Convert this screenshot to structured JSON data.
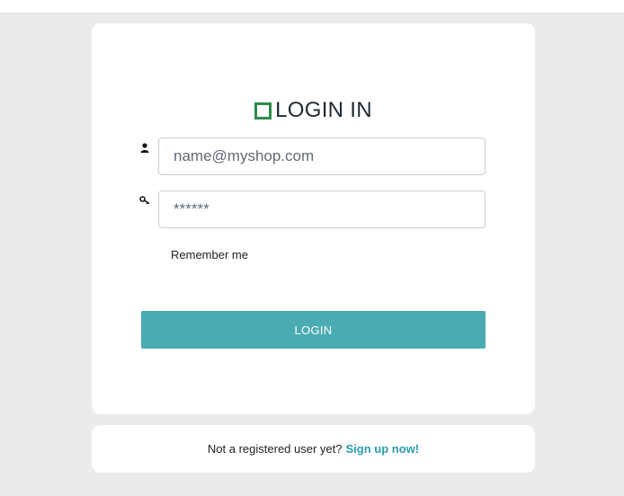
{
  "brand": {
    "title": "LOGIN IN",
    "accent_color": "#2e8b4a"
  },
  "form": {
    "email": {
      "icon": "user-icon",
      "value": "name@myshop.com"
    },
    "password": {
      "icon": "key-icon",
      "value": "******"
    },
    "remember_label": "Remember me",
    "submit_label": "LOGIN",
    "submit_color": "#4aabb3"
  },
  "signup": {
    "prompt": "Not a registered user yet?",
    "link_label": "Sign up now!",
    "link_color": "#2a9cb0"
  }
}
